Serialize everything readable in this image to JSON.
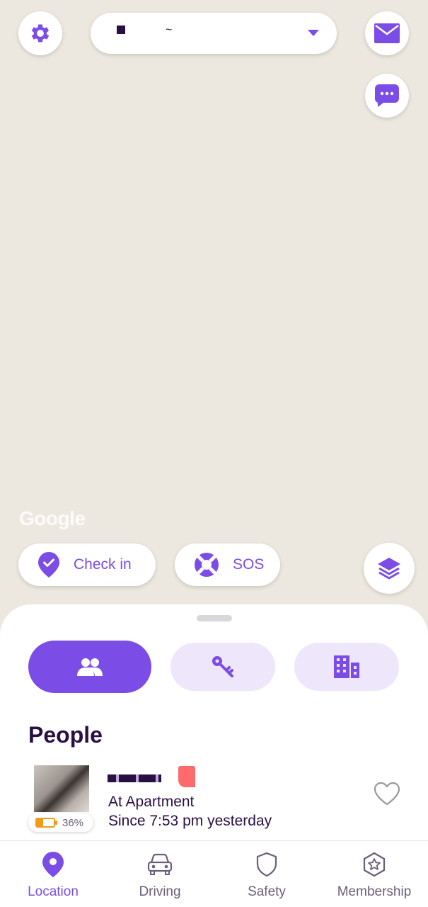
{
  "colors": {
    "accent": "#7b4ce6",
    "accent_light": "#eee7fb",
    "text_dark": "#2a0f45",
    "map_bg": "#ece8df",
    "battery_orange": "#f29b17"
  },
  "header": {
    "settings_icon": "gear-icon",
    "circle_name": "~",
    "mail_icon": "envelope-icon",
    "chat_icon": "chat-bubble-icon"
  },
  "map": {
    "attribution": "Google"
  },
  "actions": {
    "check_in": {
      "label": "Check in",
      "icon": "location-pin-check-icon"
    },
    "sos": {
      "label": "SOS",
      "icon": "lifebuoy-icon"
    },
    "layers_icon": "layers-icon"
  },
  "sheet": {
    "segments": [
      {
        "icon": "people-icon",
        "selected": true
      },
      {
        "icon": "keys-icon",
        "selected": false
      },
      {
        "icon": "building-icon",
        "selected": false
      }
    ],
    "section_title": "People",
    "people": [
      {
        "battery": "36%",
        "place": "At Apartment",
        "since": "Since 7:53 pm yesterday",
        "favorite_icon": "heart-outline-icon"
      }
    ]
  },
  "nav": {
    "items": [
      {
        "label": "Location",
        "icon": "location-pin-icon",
        "active": true
      },
      {
        "label": "Driving",
        "icon": "car-icon",
        "active": false
      },
      {
        "label": "Safety",
        "icon": "shield-icon",
        "active": false
      },
      {
        "label": "Membership",
        "icon": "star-badge-icon",
        "active": false
      }
    ]
  }
}
